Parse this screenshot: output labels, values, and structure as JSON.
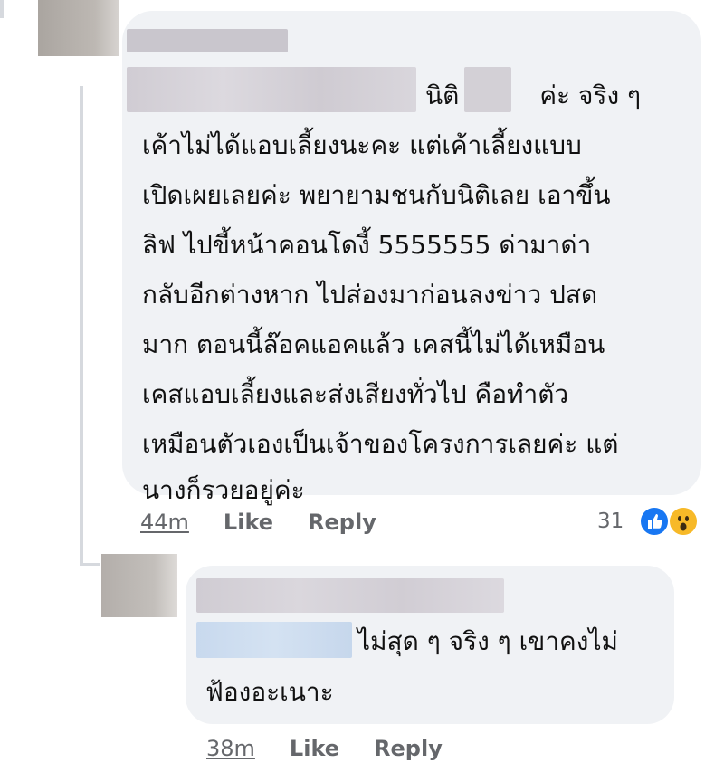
{
  "comment": {
    "text_lines": [
      "นิติ          ค่ะ จริง ๆ",
      "เค้าไม่ได้แอบเลี้ยงนะคะ แต่เค้าเลี้ยงแบบ",
      "เปิดเผยเลยค่ะ พยายามชนกับนิติเลย เอาขึ้น",
      "ลิฟ ไปขี้หน้าคอนโดงี้ 5555555 ด่ามาด่า",
      "กลับอีกต่างหาก ไปส่องมาก่อนลงข่าว ปสด",
      "มาก ตอนนี้ล๊อคแอคแล้ว เคสนี้ไม่ได้เหมือน",
      "เคสแอบเลี้ยงและส่งเสียงทั่วไป คือทำตัว",
      "เหมือนตัวเองเป็นเจ้าของโครงการเลยค่ะ แต่",
      "นางก็รวยอยู่ค่ะ"
    ],
    "time": "44m",
    "like_label": "Like",
    "reply_label": "Reply",
    "reaction_count": "31",
    "reaction_icons": [
      "like-reaction-icon",
      "wow-reaction-icon"
    ]
  },
  "reply": {
    "text_lines": [
      "ไม่สุด ๆ จริง ๆ เขาคงไม่",
      "ฟ้องอะเนาะ"
    ],
    "time": "38m",
    "like_label": "Like",
    "reply_label": "Reply"
  },
  "colors": {
    "bubble": "#f0f2f5",
    "meta": "#65676b",
    "like_blue": "#1877f2",
    "wow_yellow": "#f7b928"
  }
}
